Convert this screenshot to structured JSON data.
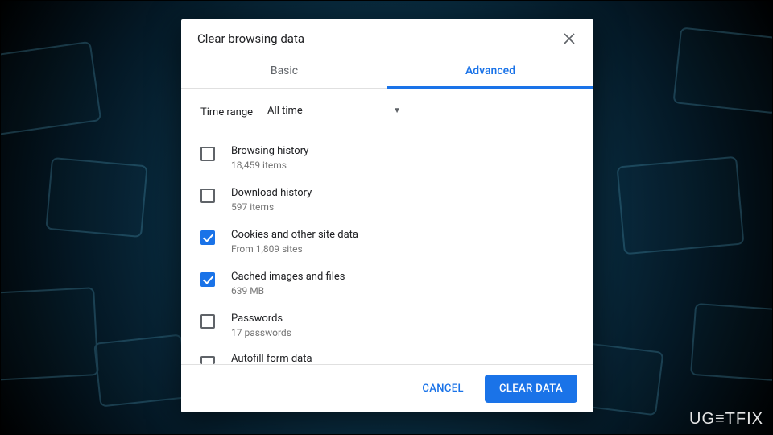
{
  "dialog": {
    "title": "Clear browsing data",
    "tabs": {
      "basic": "Basic",
      "advanced": "Advanced"
    },
    "time_range": {
      "label": "Time range",
      "value": "All time"
    },
    "items": [
      {
        "title": "Browsing history",
        "sub": "18,459 items",
        "checked": false
      },
      {
        "title": "Download history",
        "sub": "597 items",
        "checked": false
      },
      {
        "title": "Cookies and other site data",
        "sub": "From 1,809 sites",
        "checked": true
      },
      {
        "title": "Cached images and files",
        "sub": "639 MB",
        "checked": true
      },
      {
        "title": "Passwords",
        "sub": "17 passwords",
        "checked": false
      },
      {
        "title": "Autofill form data",
        "sub": "",
        "checked": false
      }
    ],
    "buttons": {
      "cancel": "CANCEL",
      "clear": "CLEAR DATA"
    }
  },
  "watermark": "UG≡TFIX"
}
